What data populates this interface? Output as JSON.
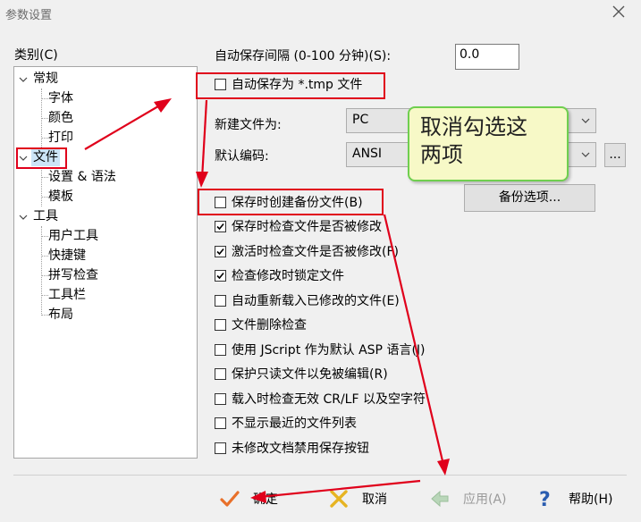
{
  "window": {
    "title": "参数设置"
  },
  "left": {
    "category_label": "类别(C)",
    "tree": [
      {
        "label": "常规",
        "expanded": true
      },
      {
        "label": "字体"
      },
      {
        "label": "颜色"
      },
      {
        "label": "打印"
      },
      {
        "label": "文件",
        "expanded": true,
        "selected": true
      },
      {
        "label": "设置 & 语法"
      },
      {
        "label": "模板"
      },
      {
        "label": "工具",
        "expanded": true
      },
      {
        "label": "用户工具"
      },
      {
        "label": "快捷键"
      },
      {
        "label": "拼写检查"
      },
      {
        "label": "工具栏"
      },
      {
        "label": "布局"
      }
    ]
  },
  "right": {
    "autosave_interval_label": "自动保存间隔 (0-100 分钟)(S):",
    "autosave_interval_value": "0.0",
    "autosave_tmp_label": "自动保存为 *.tmp 文件",
    "autosave_tmp_checked": false,
    "new_file_label": "新建文件为:",
    "new_file_value": "PC",
    "default_encoding_label": "默认编码:",
    "default_encoding_value": "ANSI",
    "ellipsis_label": "...",
    "backup_options_label": "备份选项...",
    "checkboxes": [
      {
        "label": "保存时创建备份文件(B)",
        "checked": false
      },
      {
        "label": "保存时检查文件是否被修改",
        "checked": true
      },
      {
        "label": "激活时检查文件是否被修改(F)",
        "checked": true
      },
      {
        "label": "检查修改时锁定文件",
        "checked": true
      },
      {
        "label": "自动重新载入已修改的文件(E)",
        "checked": false
      },
      {
        "label": "文件删除检查",
        "checked": false
      },
      {
        "label": "使用 JScript 作为默认 ASP 语言(J)",
        "checked": false
      },
      {
        "label": "保护只读文件以免被编辑(R)",
        "checked": false
      },
      {
        "label": "载入时检查无效 CR/LF 以及空字符",
        "checked": false
      },
      {
        "label": "不显示最近的文件列表",
        "checked": false
      },
      {
        "label": "未修改文档禁用保存按钮",
        "checked": false
      }
    ]
  },
  "annotation": {
    "note_line1": "取消勾选这",
    "note_line2": "两项",
    "color": "#e0001b"
  },
  "footer": {
    "ok_label": "确定",
    "cancel_label": "取消",
    "apply_label": "应用(A)",
    "help_label": "帮助(H)"
  },
  "colors": {
    "accent_red": "#e0001b",
    "note_bg": "#f7f9c7",
    "note_border": "#6fcf4f",
    "selection": "#cce4f7"
  }
}
